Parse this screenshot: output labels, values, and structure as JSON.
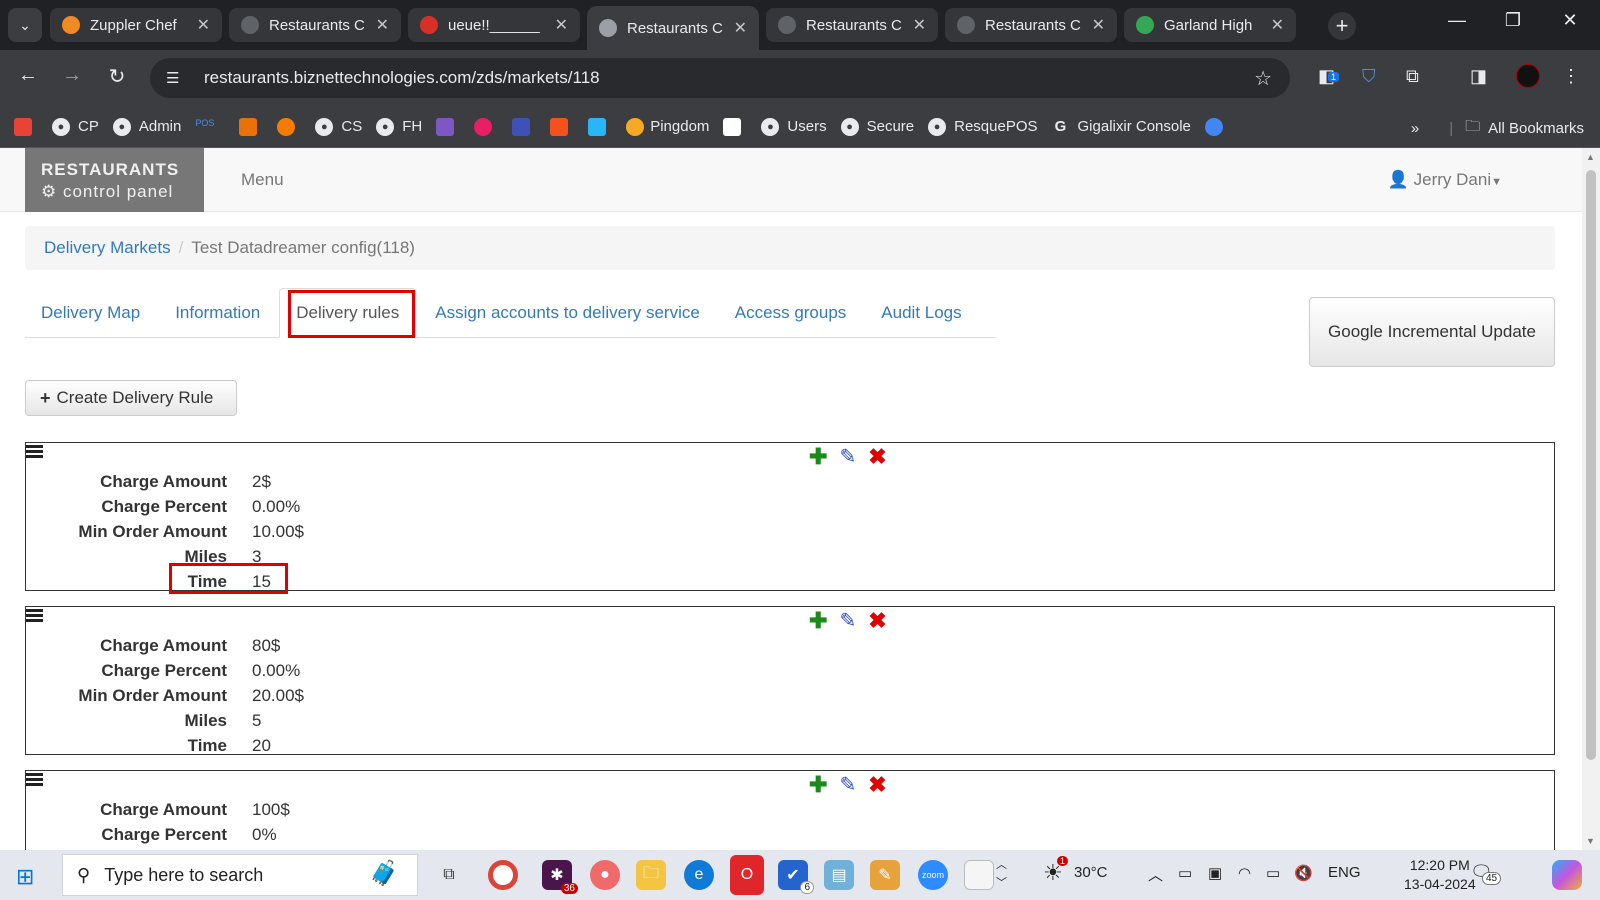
{
  "browser": {
    "tabs": [
      {
        "title": "Zuppler Chef",
        "color": "#f08a24"
      },
      {
        "title": "Restaurants C",
        "color": "#9aa0a6"
      },
      {
        "title": "ueue!!______",
        "color": "#d93025"
      },
      {
        "title": "Restaurants C",
        "color": "#9aa0a6",
        "active": true
      },
      {
        "title": "Restaurants C",
        "color": "#9aa0a6"
      },
      {
        "title": "Restaurants C",
        "color": "#9aa0a6"
      },
      {
        "title": "Garland High",
        "color": "#34a853"
      }
    ],
    "url": "restaurants.biznettechnologies.com/zds/markets/118",
    "bookmarks": [
      {
        "label": "CP"
      },
      {
        "label": "Admin"
      },
      {
        "label": "Pingdom"
      },
      {
        "label": "Users"
      },
      {
        "label": "Secure"
      },
      {
        "label": "ResquePOS"
      },
      {
        "label": "Gigalixir Console"
      }
    ],
    "all_bookmarks": "All Bookmarks",
    "ext_badge": "1"
  },
  "app": {
    "brand_line1": "RESTAURANTS",
    "brand_line2": "control panel",
    "menu": "Menu",
    "user": "Jerry Dani"
  },
  "breadcrumb": {
    "link": "Delivery Markets",
    "current": "Test Datadreamer config(118)"
  },
  "tabs": [
    {
      "label": "Delivery Map"
    },
    {
      "label": "Information"
    },
    {
      "label": "Delivery rules",
      "active": true
    },
    {
      "label": "Assign accounts to delivery service"
    },
    {
      "label": "Access groups"
    },
    {
      "label": "Audit Logs"
    }
  ],
  "google_button": "Google Incremental Update",
  "create_button": "Create Delivery Rule",
  "field_labels": {
    "charge_amount": "Charge Amount",
    "charge_percent": "Charge Percent",
    "min_order": "Min Order Amount",
    "miles": "Miles",
    "time": "Time"
  },
  "rules": [
    {
      "charge_amount": "2$",
      "charge_percent": "0.00%",
      "min_order": "10.00$",
      "miles": "3",
      "time": "15"
    },
    {
      "charge_amount": "80$",
      "charge_percent": "0.00%",
      "min_order": "20.00$",
      "miles": "5",
      "time": "20"
    },
    {
      "charge_amount": "100$",
      "charge_percent": "0%"
    }
  ],
  "taskbar": {
    "search_placeholder": "Type here to search",
    "slack_badge": "36",
    "todo_badge": "6",
    "weather_badge": "1",
    "temperature": "30°C",
    "language": "ENG",
    "time": "12:20 PM",
    "date": "13-04-2024",
    "notifications": "45"
  }
}
